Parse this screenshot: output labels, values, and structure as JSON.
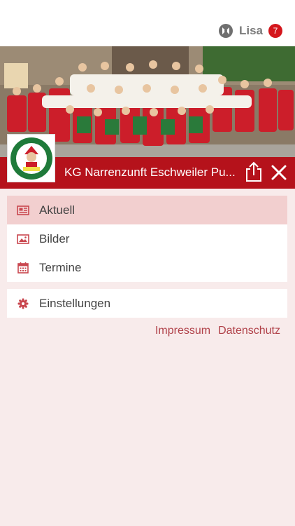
{
  "header": {
    "user_name": "Lisa",
    "notification_count": "7"
  },
  "hero": {
    "image": "club-group-photo"
  },
  "club": {
    "logo": "karneval-gesellschaft-narrenzunft-logo",
    "title": "KG Narrenzunft Eschweiler Pu..."
  },
  "menu": [
    {
      "label": "Aktuell",
      "icon": "newspaper-icon",
      "active": true
    },
    {
      "label": "Bilder",
      "icon": "image-icon",
      "active": false
    },
    {
      "label": "Termine",
      "icon": "calendar-icon",
      "active": false
    }
  ],
  "settings": {
    "label": "Einstellungen",
    "icon": "gear-icon"
  },
  "footer": {
    "impressum": "Impressum",
    "datenschutz": "Datenschutz"
  },
  "colors": {
    "brand": "#b5121b",
    "background": "#f8ebeb",
    "active_row": "#f2cfcf",
    "badge": "#d4161c"
  }
}
